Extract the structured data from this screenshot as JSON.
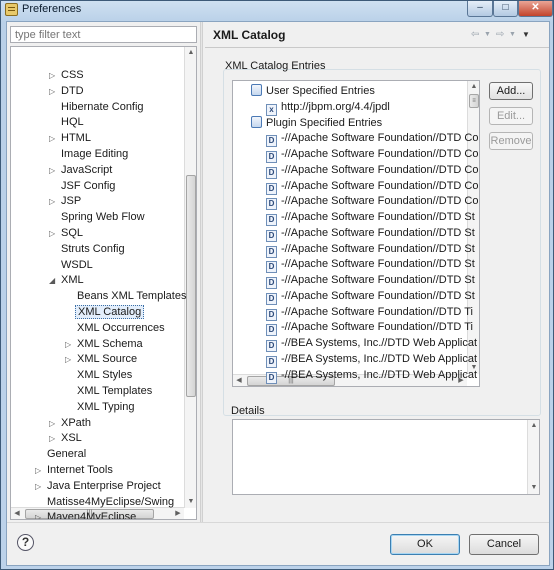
{
  "window": {
    "title": "Preferences"
  },
  "filter": {
    "placeholder": "type filter text"
  },
  "tree": [
    {
      "label": "CSS",
      "depth": 1,
      "expander": "collapsed"
    },
    {
      "label": "DTD",
      "depth": 1,
      "expander": "collapsed"
    },
    {
      "label": "Hibernate Config",
      "depth": 1,
      "expander": "none"
    },
    {
      "label": "HQL",
      "depth": 1,
      "expander": "none"
    },
    {
      "label": "HTML",
      "depth": 1,
      "expander": "collapsed"
    },
    {
      "label": "Image Editing",
      "depth": 1,
      "expander": "none"
    },
    {
      "label": "JavaScript",
      "depth": 1,
      "expander": "collapsed"
    },
    {
      "label": "JSF Config",
      "depth": 1,
      "expander": "none"
    },
    {
      "label": "JSP",
      "depth": 1,
      "expander": "collapsed"
    },
    {
      "label": "Spring Web Flow",
      "depth": 1,
      "expander": "none"
    },
    {
      "label": "SQL",
      "depth": 1,
      "expander": "collapsed"
    },
    {
      "label": "Struts Config",
      "depth": 1,
      "expander": "none"
    },
    {
      "label": "WSDL",
      "depth": 1,
      "expander": "none"
    },
    {
      "label": "XML",
      "depth": 1,
      "expander": "expanded"
    },
    {
      "label": "Beans XML Templates",
      "depth": 2,
      "expander": "none"
    },
    {
      "label": "XML Catalog",
      "depth": 2,
      "expander": "none",
      "selected": true
    },
    {
      "label": "XML Occurrences",
      "depth": 2,
      "expander": "none"
    },
    {
      "label": "XML Schema",
      "depth": 2,
      "expander": "collapsed"
    },
    {
      "label": "XML Source",
      "depth": 2,
      "expander": "collapsed"
    },
    {
      "label": "XML Styles",
      "depth": 2,
      "expander": "none"
    },
    {
      "label": "XML Templates",
      "depth": 2,
      "expander": "none"
    },
    {
      "label": "XML Typing",
      "depth": 2,
      "expander": "none"
    },
    {
      "label": "XPath",
      "depth": 1,
      "expander": "collapsed"
    },
    {
      "label": "XSL",
      "depth": 1,
      "expander": "collapsed"
    },
    {
      "label": "General",
      "depth": 0,
      "expander": "none"
    },
    {
      "label": "Internet Tools",
      "depth": 0,
      "expander": "collapsed"
    },
    {
      "label": "Java Enterprise Project",
      "depth": 0,
      "expander": "collapsed"
    },
    {
      "label": "Matisse4MyEclipse/Swing",
      "depth": 0,
      "expander": "none"
    },
    {
      "label": "Maven4MyEclipse",
      "depth": 0,
      "expander": "collapsed"
    }
  ],
  "page": {
    "title": "XML Catalog",
    "entries_label": "XML Catalog Entries",
    "details_label": "Details",
    "buttons": {
      "add": "Add...",
      "edit": "Edit...",
      "remove": "Remove"
    }
  },
  "entries": [
    {
      "text": "User Specified Entries",
      "type": "category",
      "depth": 0
    },
    {
      "text": "http://jbpm.org/4.4/jpdl",
      "type": "x",
      "depth": 1
    },
    {
      "text": "Plugin Specified Entries",
      "type": "category",
      "depth": 0
    },
    {
      "text": "-//Apache Software Foundation//DTD Co",
      "type": "d",
      "depth": 1
    },
    {
      "text": "-//Apache Software Foundation//DTD Co",
      "type": "d",
      "depth": 1
    },
    {
      "text": "-//Apache Software Foundation//DTD Co",
      "type": "d",
      "depth": 1
    },
    {
      "text": "-//Apache Software Foundation//DTD Co",
      "type": "d",
      "depth": 1
    },
    {
      "text": "-//Apache Software Foundation//DTD Co",
      "type": "d",
      "depth": 1
    },
    {
      "text": "-//Apache Software Foundation//DTD St",
      "type": "d",
      "depth": 1
    },
    {
      "text": "-//Apache Software Foundation//DTD St",
      "type": "d",
      "depth": 1
    },
    {
      "text": "-//Apache Software Foundation//DTD St",
      "type": "d",
      "depth": 1
    },
    {
      "text": "-//Apache Software Foundation//DTD St",
      "type": "d",
      "depth": 1
    },
    {
      "text": "-//Apache Software Foundation//DTD St",
      "type": "d",
      "depth": 1
    },
    {
      "text": "-//Apache Software Foundation//DTD St",
      "type": "d",
      "depth": 1
    },
    {
      "text": "-//Apache Software Foundation//DTD Ti",
      "type": "d",
      "depth": 1
    },
    {
      "text": "-//Apache Software Foundation//DTD Ti",
      "type": "d",
      "depth": 1
    },
    {
      "text": "-//BEA Systems, Inc.//DTD Web Applicat",
      "type": "d",
      "depth": 1
    },
    {
      "text": "-//BEA Systems, Inc.//DTD Web Applicat",
      "type": "d",
      "depth": 1
    },
    {
      "text": "-//BEA Systems, Inc.//DTD Web Applicat",
      "type": "d",
      "depth": 1
    }
  ],
  "dialog": {
    "ok": "OK",
    "cancel": "Cancel"
  }
}
